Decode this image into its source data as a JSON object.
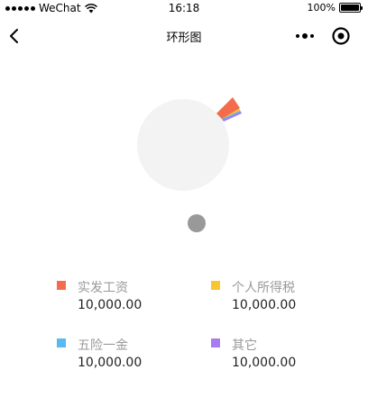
{
  "status_bar": {
    "carrier": "WeChat",
    "time": "16:18",
    "battery": "100%"
  },
  "nav": {
    "title": "环形图",
    "back_icon": "chevron-left-icon",
    "more_icon": "more-dots-icon",
    "close_icon": "target-circle-icon"
  },
  "chart_data": {
    "type": "pie",
    "series": [
      {
        "name": "实发工资",
        "value": 10000.0,
        "color": "#f56c4c"
      },
      {
        "name": "个人所得税",
        "value": 10000.0,
        "color": "#f8c730"
      },
      {
        "name": "五险一金",
        "value": 10000.0,
        "color": "#5ab9f0"
      },
      {
        "name": "其它",
        "value": 10000.0,
        "color": "#a77cf0"
      }
    ],
    "background_ring_color": "#f3f3f3"
  },
  "legend": [
    {
      "label": "实发工资",
      "value": "10,000.00",
      "color": "#f56c4c"
    },
    {
      "label": "个人所得税",
      "value": "10,000.00",
      "color": "#f8c730"
    },
    {
      "label": "五险一金",
      "value": "10,000.00",
      "color": "#5ab9f0"
    },
    {
      "label": "其它",
      "value": "10,000.00",
      "color": "#a77cf0"
    }
  ]
}
